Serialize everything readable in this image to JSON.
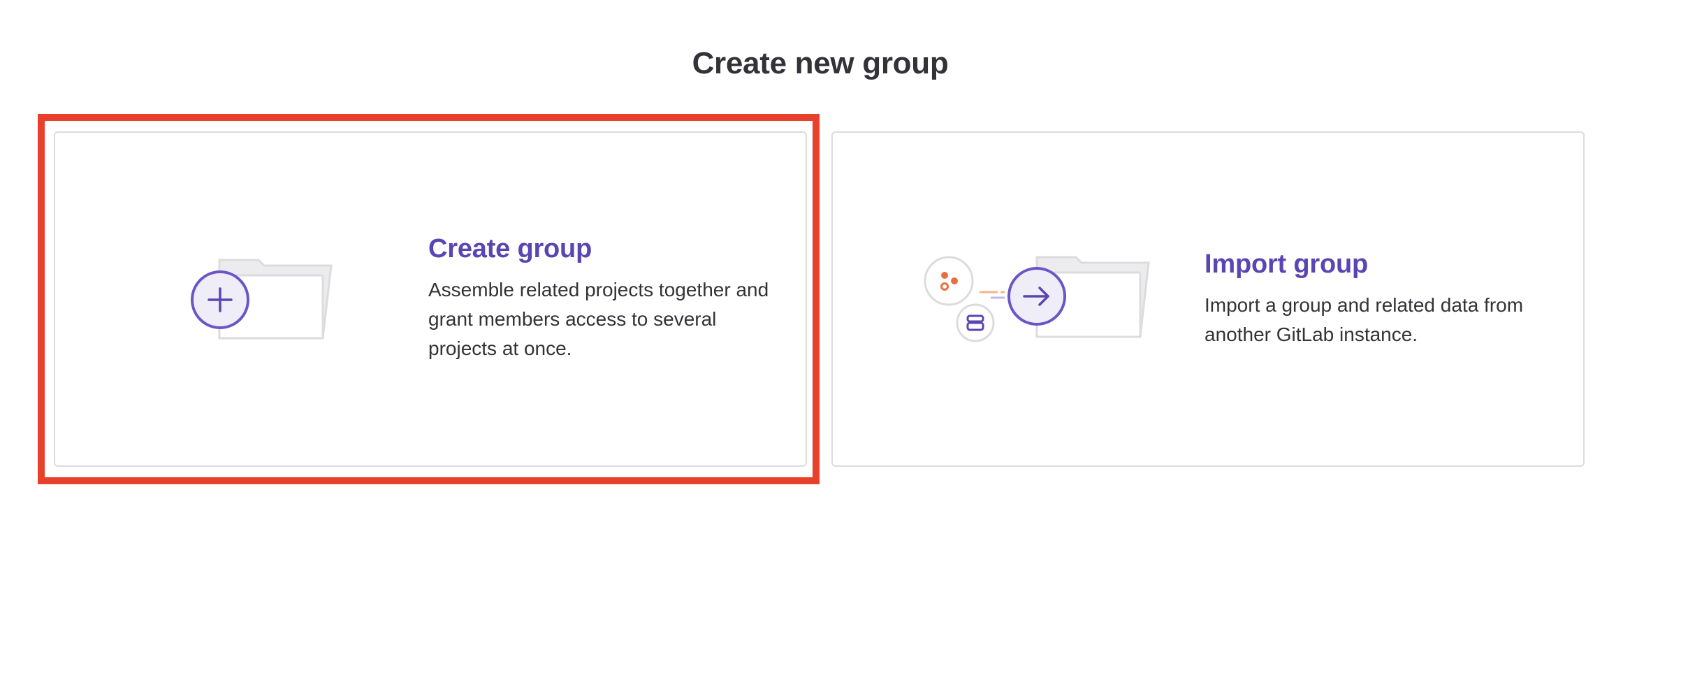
{
  "page": {
    "title": "Create new group"
  },
  "cards": {
    "create": {
      "title": "Create group",
      "description": "Assemble related projects together and grant members access to several projects at once.",
      "illustration": "folder-plus-icon",
      "highlighted": true
    },
    "import": {
      "title": "Import group",
      "description": "Import a group and related data from another GitLab instance.",
      "illustration": "folder-import-icon"
    }
  },
  "colors": {
    "accent": "#5a45b3",
    "highlight_border": "#e8402a",
    "card_border": "#dcdcde",
    "text": "#333238"
  }
}
